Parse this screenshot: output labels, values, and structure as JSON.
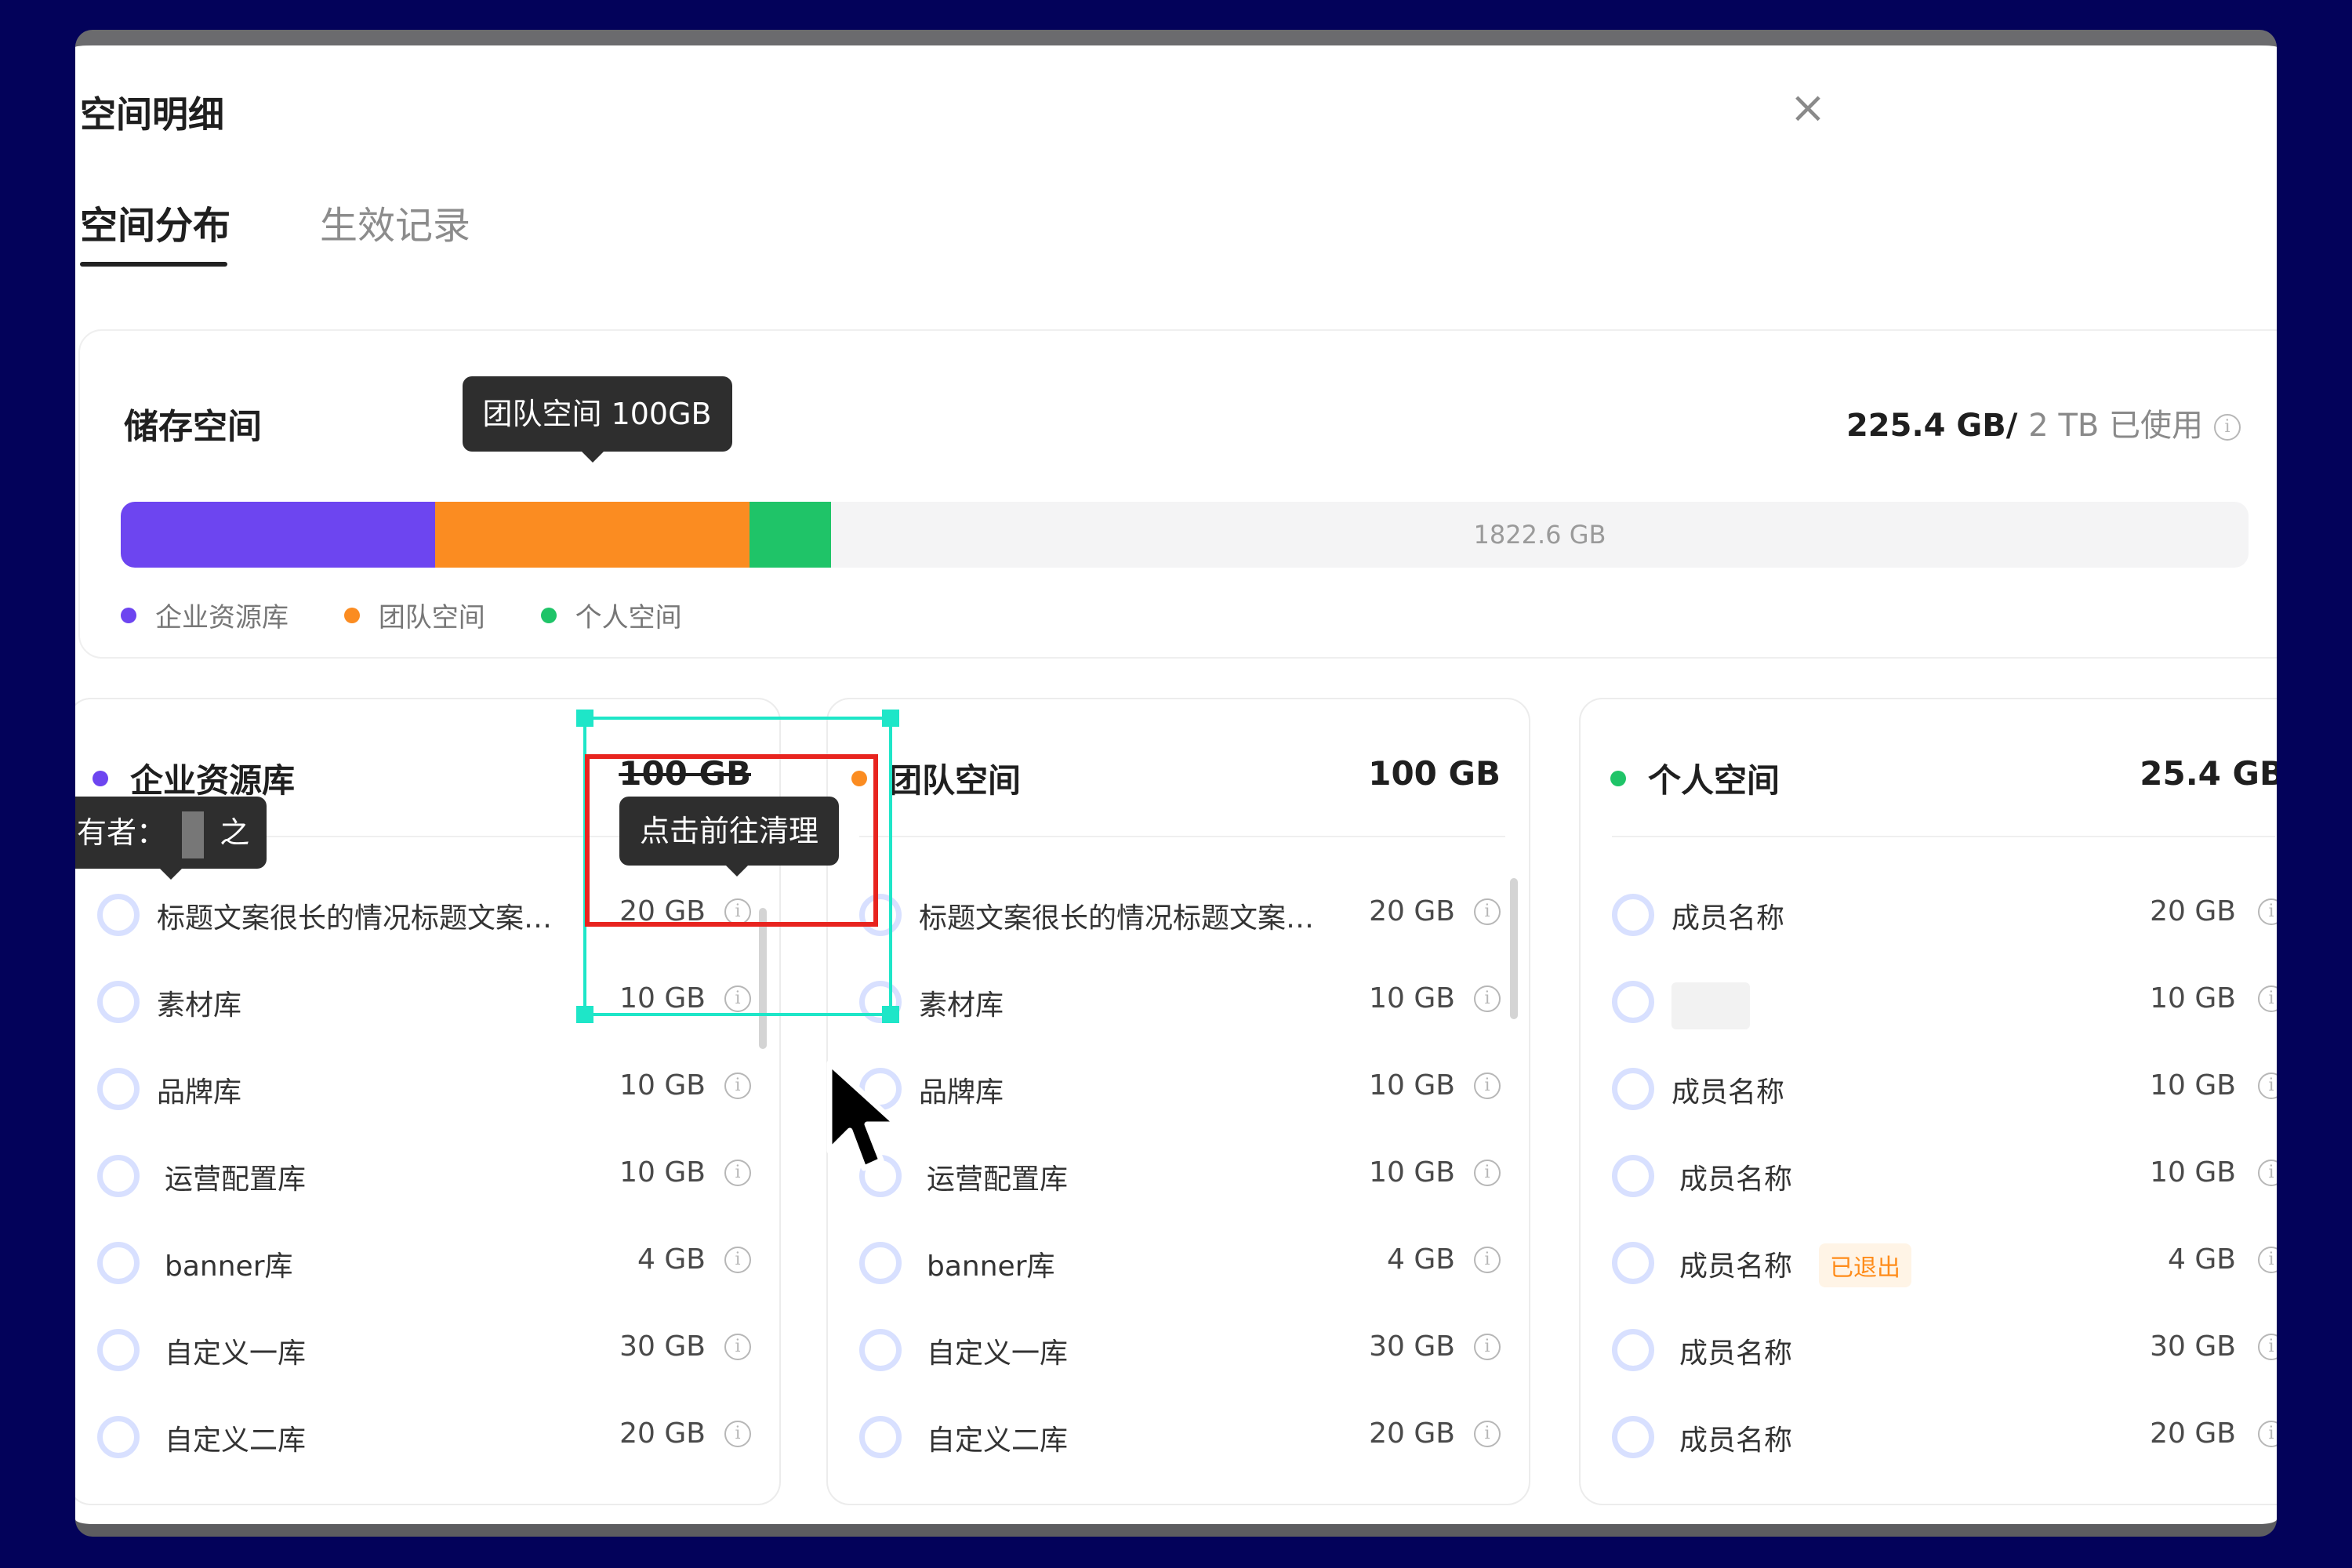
{
  "dialog": {
    "title": "空间明细",
    "close_glyph": "×",
    "tabs": [
      {
        "label": "空间分布",
        "active": true
      },
      {
        "label": "生效记录",
        "active": false
      }
    ]
  },
  "storage": {
    "title": "储存空间",
    "used": "225.4 GB/",
    "total": "2 TB 已使用",
    "free_label": "1822.6 GB",
    "segments": [
      {
        "name": "企业资源库",
        "color": "#6d45f0",
        "fraction": 0.1477
      },
      {
        "name": "团队空间",
        "color": "#fb8c21",
        "fraction": 0.1477
      },
      {
        "name": "个人空间",
        "color": "#1fc468",
        "fraction": 0.0383
      }
    ],
    "hover_tooltip": "团队空间 100GB",
    "legend": [
      {
        "label": "企业资源库",
        "color": "#6d45f0"
      },
      {
        "label": "团队空间",
        "color": "#fb8c21"
      },
      {
        "label": "个人空间",
        "color": "#1fc468"
      }
    ]
  },
  "enterprise": {
    "title": "企业资源库",
    "total": "100 GB",
    "owner_tooltip": "有者：",
    "owner_tooltip_suffix": "之",
    "clean_tooltip": "点击前往清理",
    "rows": [
      {
        "name": "标题文案很长的情况标题文案…",
        "size": "20 GB"
      },
      {
        "name": "素材库",
        "size": "10 GB"
      },
      {
        "name": "品牌库",
        "size": "10 GB"
      },
      {
        "name": "运营配置库",
        "size": "10 GB"
      },
      {
        "name": "banner库",
        "size": "4 GB"
      },
      {
        "name": "自定义一库",
        "size": "30 GB"
      },
      {
        "name": "自定义二库",
        "size": "20 GB"
      }
    ]
  },
  "team": {
    "title": "团队空间",
    "total": "100 GB",
    "rows": [
      {
        "name": "标题文案很长的情况标题文案…",
        "size": "20 GB"
      },
      {
        "name": "素材库",
        "size": "10 GB"
      },
      {
        "name": "品牌库",
        "size": "10 GB"
      },
      {
        "name": "运营配置库",
        "size": "10 GB"
      },
      {
        "name": "banner库",
        "size": "4 GB"
      },
      {
        "name": "自定义一库",
        "size": "30 GB"
      },
      {
        "name": "自定义二库",
        "size": "20 GB"
      }
    ]
  },
  "personal": {
    "title": "个人空间",
    "total": "25.4 GB",
    "exited_badge": "已退出",
    "rows": [
      {
        "name": "成员名称",
        "size": "20 GB"
      },
      {
        "name": "",
        "size": "10 GB"
      },
      {
        "name": "成员名称",
        "size": "10 GB"
      },
      {
        "name": "成员名称",
        "size": "10 GB"
      },
      {
        "name": "成员名称",
        "size": "4 GB"
      },
      {
        "name": "成员名称",
        "size": "30 GB"
      },
      {
        "name": "成员名称",
        "size": "20 GB"
      }
    ]
  }
}
